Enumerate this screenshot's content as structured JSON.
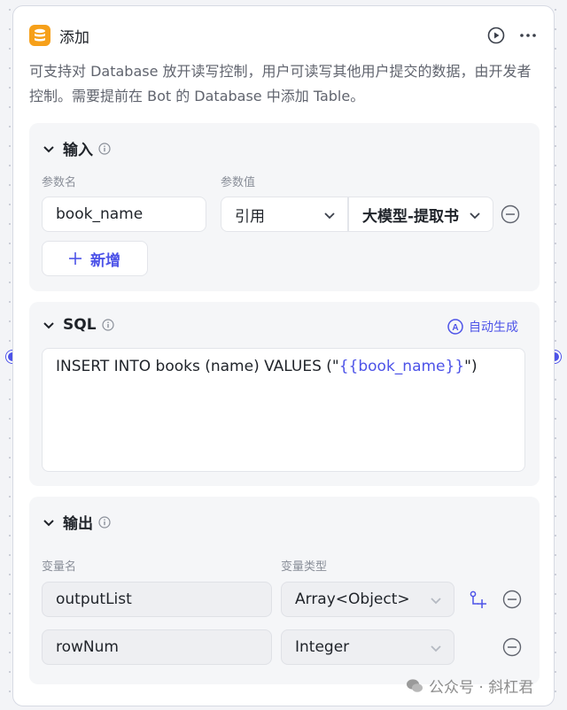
{
  "node": {
    "title": "添加",
    "description": "可支持对 Database 放开读写控制，用户可读写其他用户提交的数据，由开发者控制。需要提前在 Bot 的 Database 中添加 Table。"
  },
  "input_section": {
    "title": "输入",
    "col_name_label": "参数名",
    "col_value_label": "参数值",
    "param_name": "book_name",
    "ref_type": "引用",
    "ref_source": "大模型-提取书",
    "add_label": "新增"
  },
  "sql_section": {
    "title": "SQL",
    "auto_label": "自动生成",
    "query_prefix": "INSERT INTO books (name) VALUES (\"",
    "query_var": "{{book_name}}",
    "query_suffix": "\")"
  },
  "output_section": {
    "title": "输出",
    "col_name_label": "变量名",
    "col_type_label": "变量类型",
    "rows": [
      {
        "name": "outputList",
        "type": "Array<Object>"
      },
      {
        "name": "rowNum",
        "type": "Integer"
      }
    ]
  },
  "watermark": {
    "text": "公众号 · 斜杠君"
  },
  "colors": {
    "accent": "#4d53e8",
    "node_icon": "#f6a01a"
  }
}
